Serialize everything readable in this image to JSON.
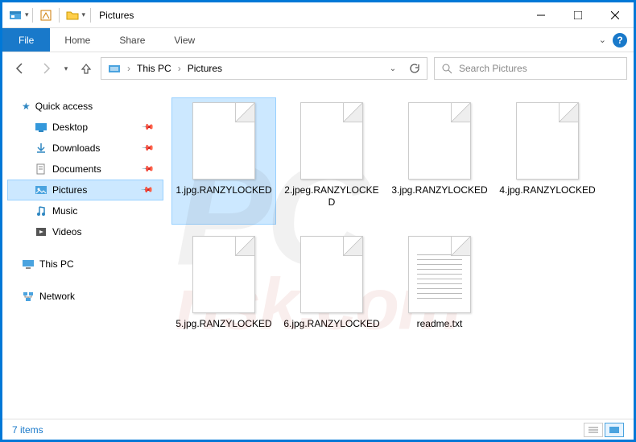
{
  "window": {
    "title": "Pictures",
    "controls": {
      "minimize": "—",
      "maximize": "□",
      "close": "✕"
    }
  },
  "ribbon": {
    "file": "File",
    "tabs": [
      "Home",
      "Share",
      "View"
    ]
  },
  "address": {
    "crumbs": [
      "This PC",
      "Pictures"
    ]
  },
  "search": {
    "placeholder": "Search Pictures"
  },
  "sidebar": {
    "quick_access": "Quick access",
    "items": [
      {
        "label": "Desktop",
        "pinned": true,
        "icon": "desktop"
      },
      {
        "label": "Downloads",
        "pinned": true,
        "icon": "downloads"
      },
      {
        "label": "Documents",
        "pinned": true,
        "icon": "documents"
      },
      {
        "label": "Pictures",
        "pinned": true,
        "icon": "pictures",
        "selected": true
      },
      {
        "label": "Music",
        "pinned": false,
        "icon": "music"
      },
      {
        "label": "Videos",
        "pinned": false,
        "icon": "videos"
      }
    ],
    "this_pc": "This PC",
    "network": "Network"
  },
  "files": [
    {
      "name": "1.jpg.RANZYLOCKED",
      "type": "file"
    },
    {
      "name": "2.jpeg.RANZYLOCKED",
      "type": "file"
    },
    {
      "name": "3.jpg.RANZYLOCKED",
      "type": "file"
    },
    {
      "name": "4.jpg.RANZYLOCKED",
      "type": "file"
    },
    {
      "name": "5.jpg.RANZYLOCKED",
      "type": "file"
    },
    {
      "name": "6.jpg.RANZYLOCKED",
      "type": "file"
    },
    {
      "name": "readme.txt",
      "type": "txt"
    }
  ],
  "status": {
    "count_label": "7 items"
  },
  "watermark": {
    "line1": "PC",
    "line2": "risk.com"
  }
}
